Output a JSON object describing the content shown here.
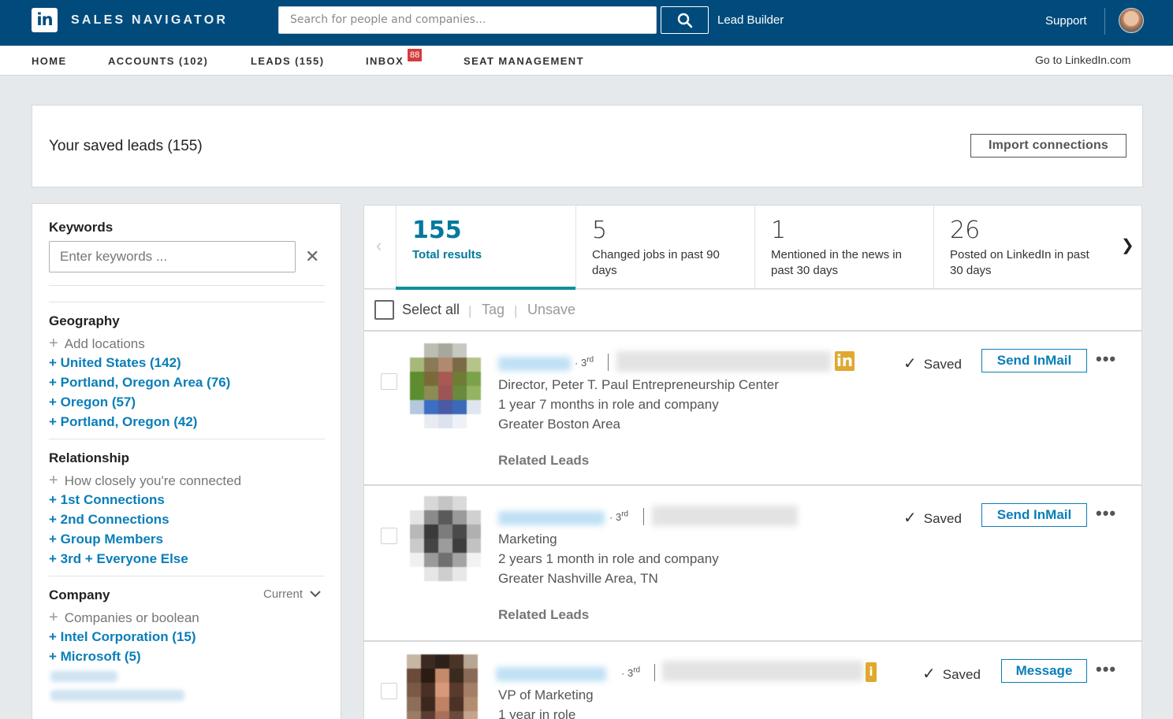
{
  "topbar": {
    "logo": "in",
    "brand": "SALES NAVIGATOR",
    "search_placeholder": "Search for people and companies...",
    "lead_builder": "Lead Builder",
    "support": "Support"
  },
  "nav": {
    "home": "HOME",
    "accounts": "ACCOUNTS (102)",
    "leads": "LEADS (155)",
    "inbox": "INBOX",
    "inbox_badge": "88",
    "seat_management": "SEAT MANAGEMENT",
    "goto_linkedin": "Go to LinkedIn.com"
  },
  "header": {
    "title": "Your saved leads (155)",
    "import_button": "Import connections"
  },
  "filters": {
    "keywords": {
      "heading": "Keywords",
      "placeholder": "Enter keywords ..."
    },
    "geography": {
      "heading": "Geography",
      "add": "Add locations",
      "items": [
        "+ United States (142)",
        "+ Portland, Oregon Area (76)",
        "+ Oregon (57)",
        "+ Portland, Oregon (42)"
      ]
    },
    "relationship": {
      "heading": "Relationship",
      "add": "How closely you're connected",
      "items": [
        "+ 1st Connections",
        "+ 2nd Connections",
        "+ Group Members",
        "+ 3rd + Everyone Else"
      ]
    },
    "company": {
      "heading": "Company",
      "scope": "Current",
      "add": "Companies or boolean",
      "items": [
        "+ Intel Corporation (15)",
        "+ Microsoft (5)"
      ]
    }
  },
  "stats": [
    {
      "number": "155",
      "label": "Total results"
    },
    {
      "number": "5",
      "label": "Changed jobs in past 90 days"
    },
    {
      "number": "1",
      "label": "Mentioned in the news in past 30 days"
    },
    {
      "number": "26",
      "label": "Posted on LinkedIn in past 30 days"
    }
  ],
  "toolbar": {
    "select_all": "Select all",
    "tag": "Tag",
    "unsave": "Unsave"
  },
  "leads": [
    {
      "degree": "3rd",
      "title": "Director, Peter T. Paul Entrepreneurship Center",
      "tenure": "1 year 7 months in role and company",
      "location": "Greater Boston Area",
      "related": "Related Leads",
      "saved": "Saved",
      "action": "Send InMail"
    },
    {
      "degree": "3rd",
      "title": "Marketing",
      "tenure": "2 years 1 month in role and company",
      "location": "Greater Nashville Area, TN",
      "related": "Related Leads",
      "saved": "Saved",
      "action": "Send InMail"
    },
    {
      "degree": "3rd",
      "title": "VP of Marketing",
      "tenure": "1 year in role",
      "saved": "Saved",
      "action": "Message"
    }
  ],
  "icons": {
    "search": "search-icon",
    "close": "close-icon",
    "chevron_down": "chevron-down-icon",
    "chevron_left": "chevron-left-icon",
    "chevron_right": "chevron-right-icon",
    "check": "check-icon",
    "more": "more-icon"
  },
  "colors": {
    "topbar": "#004b7c",
    "link": "#0a7eb8",
    "accent_teal": "#00799c",
    "badge_red": "#d53b3b",
    "in_badge": "#e0a82e"
  }
}
